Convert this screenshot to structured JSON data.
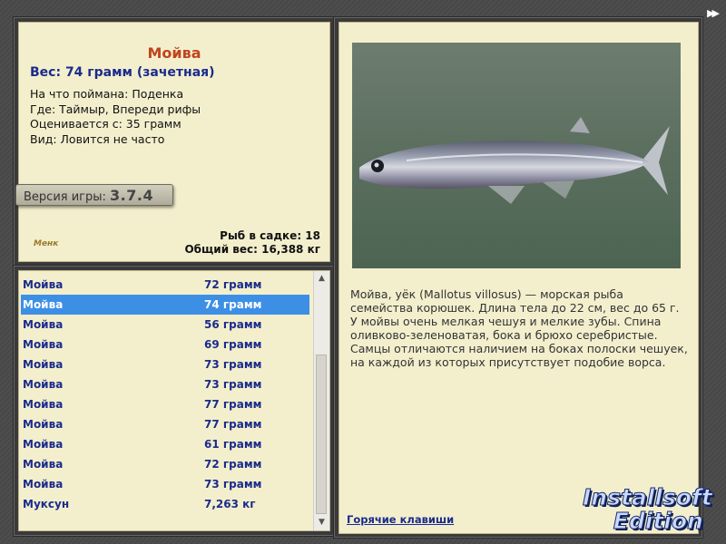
{
  "fish": {
    "name": "Мойва",
    "weight": "Вес: 74 грамм (зачетная)",
    "props": [
      "На что поймана: Поденка",
      "Где: Таймыр, Впереди рифы",
      "Оценивается с: 35 грамм",
      "Вид: Ловится не часто"
    ]
  },
  "version": {
    "label": "Версия игры:",
    "value": "3.7.4"
  },
  "logo_small": "Менк",
  "stats": {
    "fish_count": "Рыб в садке: 18",
    "total_weight": "Общий вес: 16,388 кг"
  },
  "catch_list": [
    {
      "name": "Мойва",
      "weight": "72 грамм"
    },
    {
      "name": "Мойва",
      "weight": "74 грамм",
      "selected": true
    },
    {
      "name": "Мойва",
      "weight": "56 грамм"
    },
    {
      "name": "Мойва",
      "weight": "69 грамм"
    },
    {
      "name": "Мойва",
      "weight": "73 грамм"
    },
    {
      "name": "Мойва",
      "weight": "73 грамм"
    },
    {
      "name": "Мойва",
      "weight": "77 грамм"
    },
    {
      "name": "Мойва",
      "weight": "77 грамм"
    },
    {
      "name": "Мойва",
      "weight": "61 грамм"
    },
    {
      "name": "Мойва",
      "weight": "72 грамм"
    },
    {
      "name": "Мойва",
      "weight": "73 грамм"
    },
    {
      "name": "Муксун",
      "weight": "7,263 кг"
    }
  ],
  "description": "Мойва, уёк (Mallotus villosus) — морская рыба семейства корюшек. Длина тела до 22 см, вес до 65 г. У мойвы очень мелкая чешуя и мелкие зубы. Спина оливково-зеленоватая, бока и брюхо серебристые. Самцы отличаются наличием на боках полоски чешуек, на каждой из которых присутствует подобие ворса.",
  "hotkeys_link": "Горячие клавиши",
  "nav": {
    "fast_forward": "▶▶"
  },
  "brand": {
    "line1": "Installsoft",
    "line2": "Edition"
  },
  "icons": {
    "scroll_up": "▲",
    "scroll_down": "▼"
  }
}
